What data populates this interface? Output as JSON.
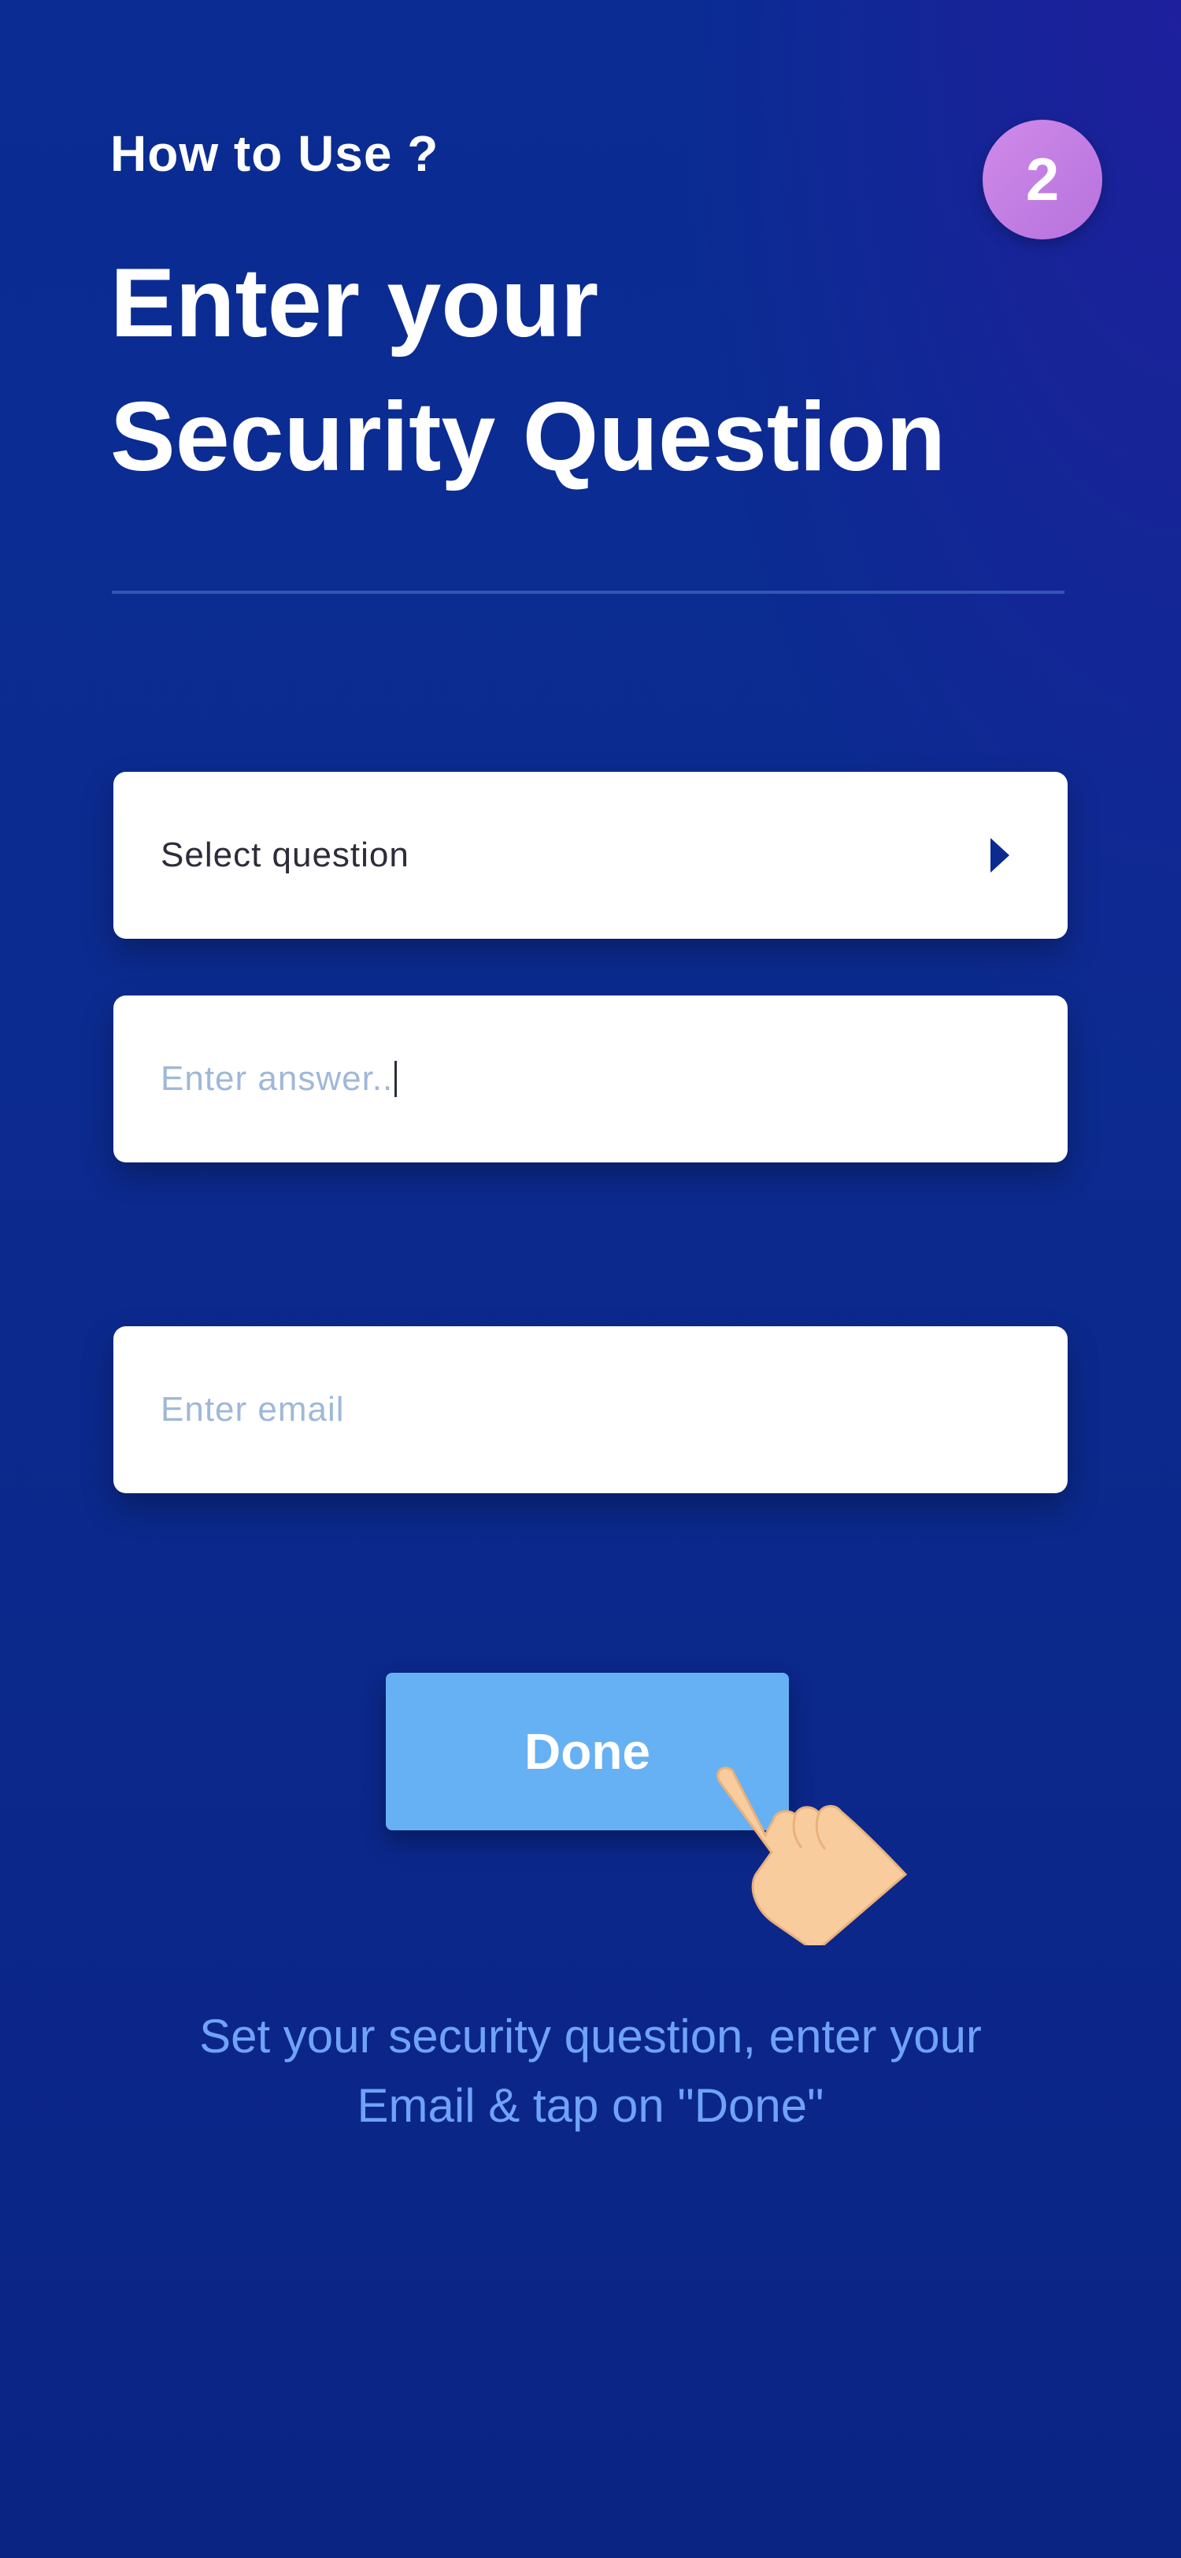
{
  "header": {
    "hint": "How to Use ?",
    "step_number": "2",
    "title_line1": "Enter your",
    "title_line2": "Security Question"
  },
  "form": {
    "question_select": {
      "value": "Select question",
      "icon": "chevron-right-icon"
    },
    "answer_input": {
      "placeholder": "Enter answer.."
    },
    "email_input": {
      "placeholder": "Enter email"
    },
    "done_label": "Done"
  },
  "instruction": {
    "line1": "Set your security question, enter your",
    "line2": "Email & tap on \"Done\""
  },
  "colors": {
    "background": "#0c2b90",
    "badge": "#c47ee4",
    "button": "#66b1f4",
    "instruction_text": "#6fa3f7",
    "placeholder_text": "#9fb8d8"
  }
}
